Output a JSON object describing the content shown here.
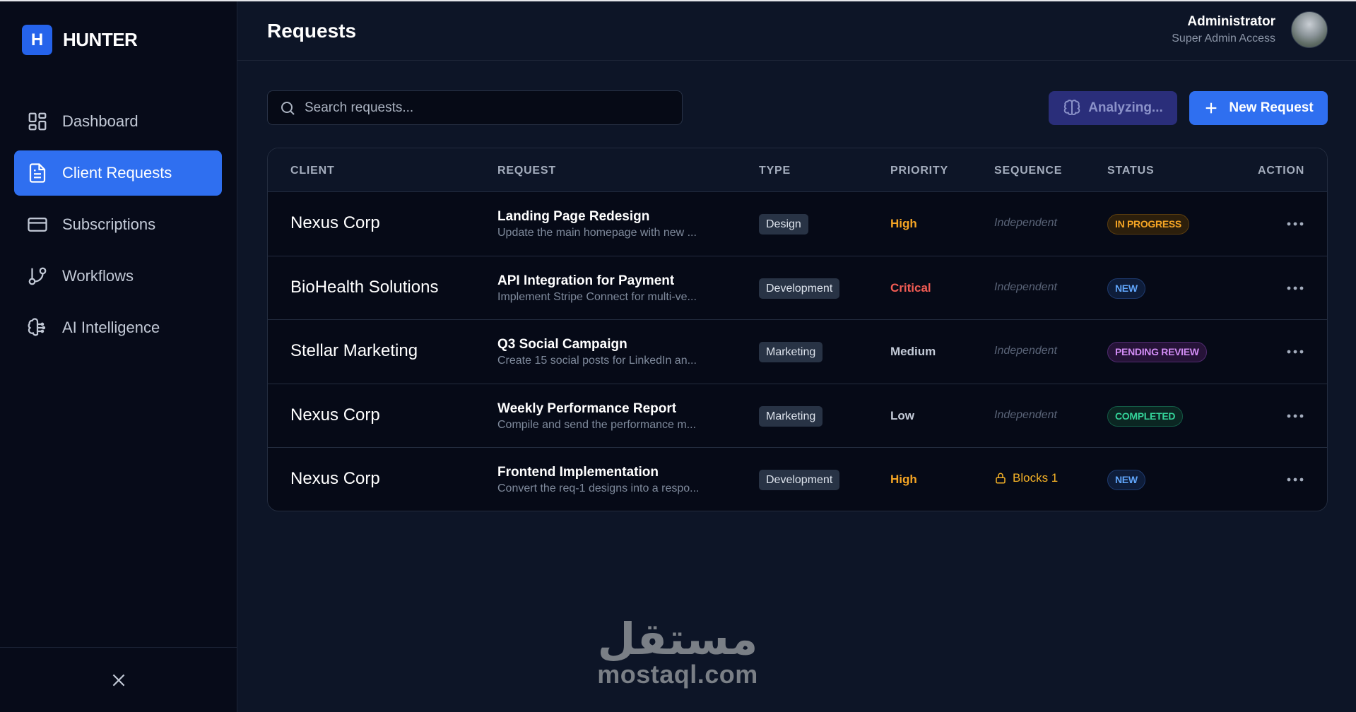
{
  "brand": {
    "badge": "H",
    "name": "HUNTER"
  },
  "sidebar": {
    "items": [
      {
        "label": "Dashboard",
        "icon": "dashboard-grid-icon",
        "active": false
      },
      {
        "label": "Client Requests",
        "icon": "document-icon",
        "active": true
      },
      {
        "label": "Subscriptions",
        "icon": "credit-card-icon",
        "active": false
      },
      {
        "label": "Workflows",
        "icon": "git-branch-icon",
        "active": false
      },
      {
        "label": "AI Intelligence",
        "icon": "brain-icon",
        "active": false
      }
    ],
    "collapse_icon": "close-icon"
  },
  "header": {
    "title": "Requests",
    "user": {
      "name": "Administrator",
      "role": "Super Admin Access"
    }
  },
  "toolbar": {
    "search_placeholder": "Search requests...",
    "analyze_label": "Analyzing...",
    "new_label": "New Request"
  },
  "table": {
    "columns": [
      "CLIENT",
      "REQUEST",
      "TYPE",
      "PRIORITY",
      "SEQUENCE",
      "STATUS",
      "ACTION"
    ],
    "rows": [
      {
        "client": "Nexus Corp",
        "title": "Landing Page Redesign",
        "desc": "Update the main homepage with new ...",
        "type": "Design",
        "priority": "High",
        "sequence": "Independent",
        "status": "IN PROGRESS"
      },
      {
        "client": "BioHealth Solutions",
        "title": "API Integration for Payment",
        "desc": "Implement Stripe Connect for multi-ve...",
        "type": "Development",
        "priority": "Critical",
        "sequence": "Independent",
        "status": "NEW"
      },
      {
        "client": "Stellar Marketing",
        "title": "Q3 Social Campaign",
        "desc": "Create 15 social posts for LinkedIn an...",
        "type": "Marketing",
        "priority": "Medium",
        "sequence": "Independent",
        "status": "PENDING REVIEW"
      },
      {
        "client": "Nexus Corp",
        "title": "Weekly Performance Report",
        "desc": "Compile and send the performance m...",
        "type": "Marketing",
        "priority": "Low",
        "sequence": "Independent",
        "status": "COMPLETED"
      },
      {
        "client": "Nexus Corp",
        "title": "Frontend Implementation",
        "desc": "Convert the req-1 designs into a respo...",
        "type": "Development",
        "priority": "High",
        "sequence": "Blocks 1",
        "status": "NEW"
      }
    ]
  },
  "colors": {
    "accent": "#2f6ff0",
    "priority_high": "#f5a524",
    "priority_critical": "#f25c54",
    "priority_medium": "#c3cad7",
    "priority_low": "#c3cad7"
  },
  "watermark": {
    "arabic": "مستقل",
    "latin": "mostaql.com"
  }
}
